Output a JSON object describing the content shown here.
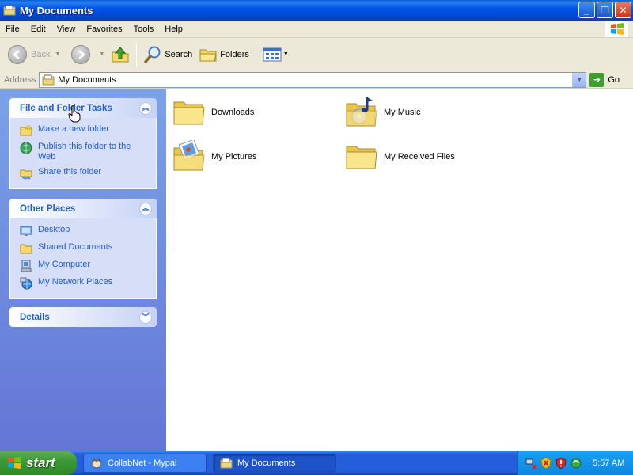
{
  "window": {
    "title": "My Documents",
    "minimize_glyph": "_",
    "maximize_glyph": "❐",
    "close_glyph": "✕"
  },
  "menu": [
    "File",
    "Edit",
    "View",
    "Favorites",
    "Tools",
    "Help"
  ],
  "toolbar": {
    "back_label": "Back",
    "search_label": "Search",
    "folders_label": "Folders"
  },
  "address": {
    "label": "Address",
    "value": "My Documents",
    "go_label": "Go"
  },
  "file_folder_tasks": {
    "title": "File and Folder Tasks",
    "items": [
      {
        "label": "Make a new folder",
        "icon": "new-folder-icon"
      },
      {
        "label": "Publish this folder to the Web",
        "icon": "publish-web-icon"
      },
      {
        "label": "Share this folder",
        "icon": "share-folder-icon"
      }
    ]
  },
  "other_places": {
    "title": "Other Places",
    "items": [
      {
        "label": "Desktop",
        "icon": "desktop-icon"
      },
      {
        "label": "Shared Documents",
        "icon": "folder-icon"
      },
      {
        "label": "My Computer",
        "icon": "computer-icon"
      },
      {
        "label": "My Network Places",
        "icon": "network-icon"
      }
    ]
  },
  "details": {
    "title": "Details"
  },
  "files": [
    {
      "name": "Downloads",
      "icon": "folder-icon"
    },
    {
      "name": "My Music",
      "icon": "music-folder-icon"
    },
    {
      "name": "My Pictures",
      "icon": "pictures-folder-icon"
    },
    {
      "name": "My Received Files",
      "icon": "folder-icon"
    }
  ],
  "taskbar": {
    "start_label": "start",
    "tasks": [
      {
        "label": "CollabNet - Mypal"
      },
      {
        "label": "My Documents",
        "active": true
      }
    ],
    "clock": "5:57 AM"
  },
  "colors": {
    "titlebar": "#0055e5",
    "taskpane": "#6375d6",
    "link": "#215dc6",
    "taskbar": "#245edb",
    "start": "#3c9a34"
  }
}
